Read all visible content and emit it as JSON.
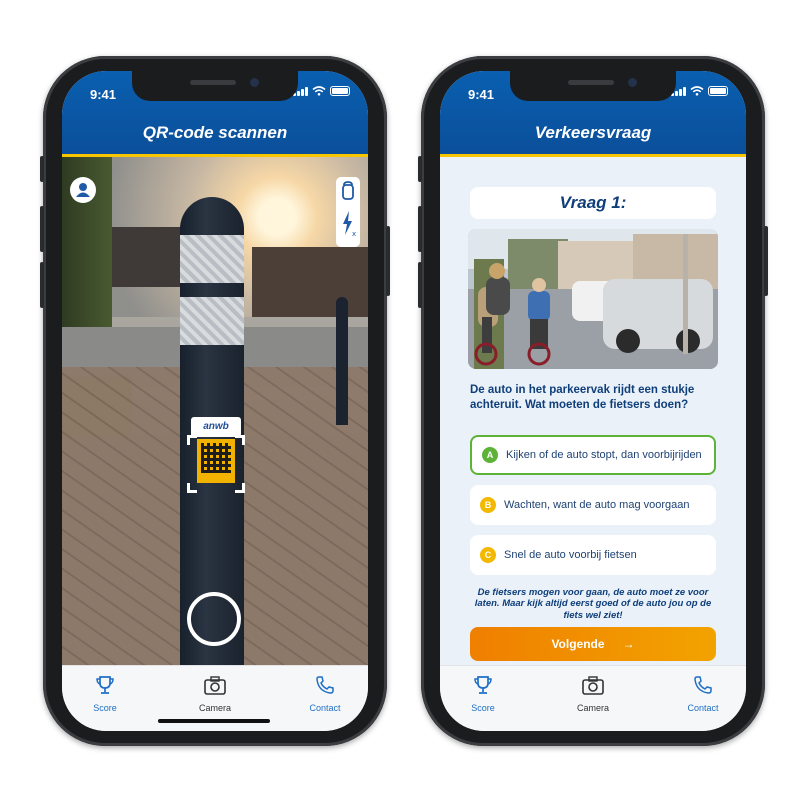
{
  "status_time": "9:41",
  "scanner": {
    "title": "QR-code scannen",
    "sticker_logo": "anwb"
  },
  "question": {
    "title": "Vraag 1:",
    "text": "De auto in het parkeervak rijdt een stukje achteruit. Wat moeten de fietsers doen?",
    "answers": [
      {
        "letter": "A",
        "text": "Kijken of de auto stopt, dan voorbijrijden",
        "color": "#5cb338",
        "selected": true
      },
      {
        "letter": "B",
        "text": "Wachten, want de auto mag voorgaan",
        "color": "#f3b800",
        "selected": false
      },
      {
        "letter": "C",
        "text": "Snel de auto voorbij fietsen",
        "color": "#f3b800",
        "selected": false
      }
    ],
    "feedback": "De fietsers mogen voor gaan, de auto moet ze voor laten. Maar kijk altijd eerst goed of de auto jou op de fiets wel ziet!",
    "next_label": "Volgende",
    "next_arrow": "→"
  },
  "tabs": [
    {
      "label": "Score",
      "icon": "trophy-icon"
    },
    {
      "label": "Camera",
      "icon": "camera-icon"
    },
    {
      "label": "Contact",
      "icon": "phone-icon"
    }
  ],
  "question_screen_title": "Verkeersvraag",
  "colors": {
    "brand_blue": "#0b4f9a",
    "accent_yellow": "#f7c600",
    "selected_green": "#5cb338",
    "button_orange": "#f07f00"
  }
}
